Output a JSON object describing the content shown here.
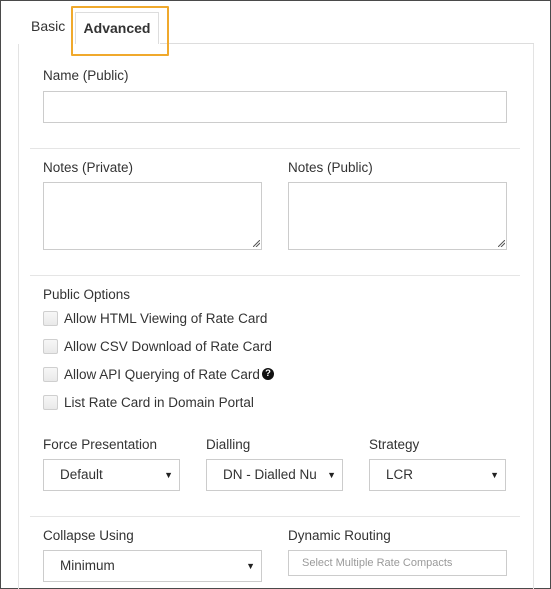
{
  "tabs": [
    {
      "label": "Basic"
    },
    {
      "label": "Advanced"
    }
  ],
  "name_public": {
    "label": "Name (Public)",
    "value": ""
  },
  "notes_private": {
    "label": "Notes (Private)",
    "value": ""
  },
  "notes_public": {
    "label": "Notes (Public)",
    "value": ""
  },
  "public_options": {
    "heading": "Public Options",
    "items": [
      {
        "label": "Allow HTML Viewing of Rate Card",
        "checked": false
      },
      {
        "label": "Allow CSV Download of Rate Card",
        "checked": false
      },
      {
        "label": "Allow API Querying of Rate Card",
        "checked": false
      },
      {
        "label": "List Rate Card in Domain Portal",
        "checked": false
      }
    ],
    "help_glyph": "?"
  },
  "force_presentation": {
    "label": "Force Presentation",
    "value": "Default"
  },
  "dialling": {
    "label": "Dialling",
    "value": "DN - Dialled Nu"
  },
  "strategy": {
    "label": "Strategy",
    "value": "LCR"
  },
  "collapse_using": {
    "label": "Collapse Using",
    "value": "Minimum"
  },
  "dynamic_routing": {
    "label": "Dynamic Routing",
    "placeholder": "Select Multiple Rate Compacts"
  },
  "colors": {
    "highlight": "#f0a92c",
    "border": "#cccccc"
  },
  "icons": {
    "dropdown": "caret-down-icon",
    "help": "question-circle-icon"
  }
}
